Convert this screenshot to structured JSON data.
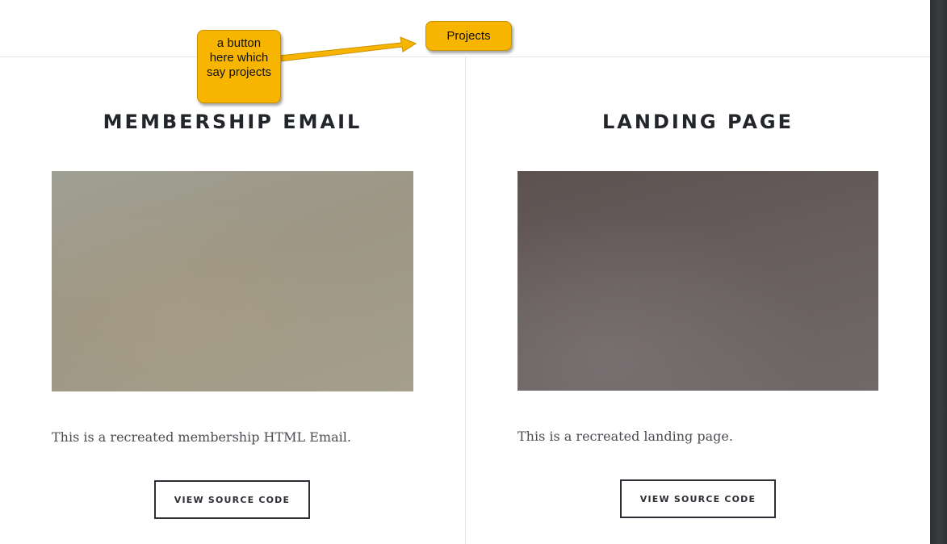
{
  "cards": [
    {
      "title": "MEMBERSHIP EMAIL",
      "description": "This is a recreated membership HTML Email.",
      "button_label": "VIEW SOURCE CODE"
    },
    {
      "title": "LANDING PAGE",
      "description": "This is a recreated landing page.",
      "button_label": "VIEW SOURCE CODE"
    }
  ],
  "annotations": {
    "callout_text": "a button here which say projects",
    "projects_label": "Projects",
    "color": "#f7b500"
  }
}
